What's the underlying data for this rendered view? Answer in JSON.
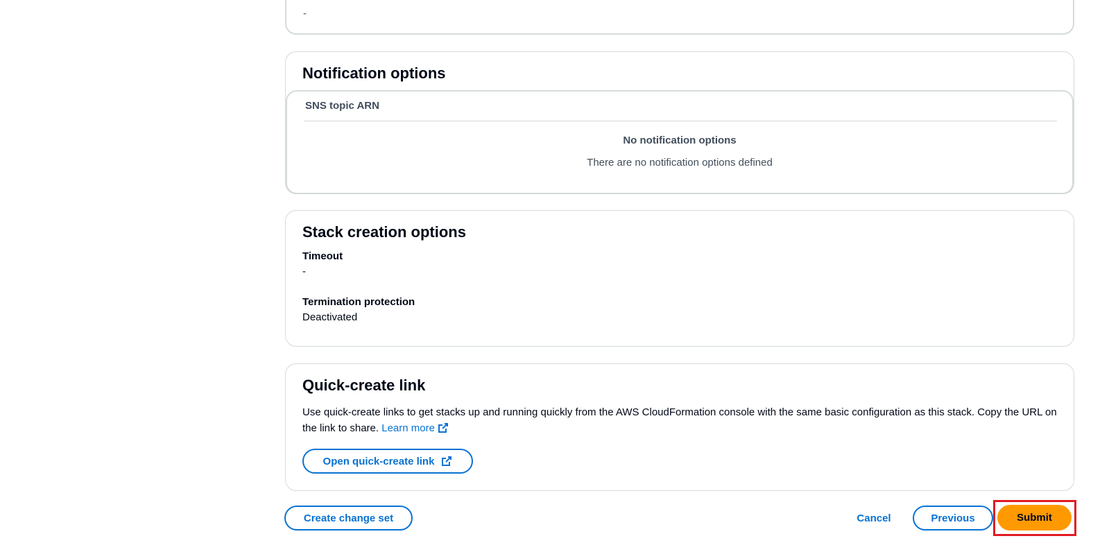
{
  "previous_section": {
    "value": "-"
  },
  "notification_options": {
    "title": "Notification options",
    "column_header": "SNS topic ARN",
    "empty_title": "No notification options",
    "empty_description": "There are no notification options defined"
  },
  "stack_creation_options": {
    "title": "Stack creation options",
    "fields": [
      {
        "label": "Timeout",
        "value": "-"
      },
      {
        "label": "Termination protection",
        "value": "Deactivated"
      }
    ]
  },
  "quick_create_link": {
    "title": "Quick-create link",
    "description": "Use quick-create links to get stacks up and running quickly from the AWS CloudFormation console with the same basic configuration as this stack. Copy the URL on the link to share.",
    "learn_more": "Learn more",
    "open_button": "Open quick-create link"
  },
  "actions": {
    "create_change_set": "Create change set",
    "cancel": "Cancel",
    "previous": "Previous",
    "submit": "Submit"
  },
  "icons": {
    "external_link": "external-link-icon"
  },
  "colors": {
    "link": "#0972d3",
    "primary_button": "#ff9900",
    "highlight": "#e01b24",
    "border": "#d5dbdb"
  }
}
